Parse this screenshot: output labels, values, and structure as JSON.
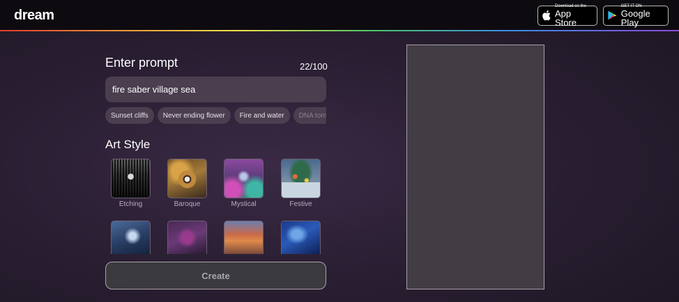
{
  "header": {
    "logo": "dream",
    "app_store": {
      "small": "Download on the",
      "big": "App Store"
    },
    "google_play": {
      "small": "GET IT ON",
      "big": "Google Play"
    }
  },
  "prompt": {
    "title": "Enter prompt",
    "counter": "22/100",
    "value": "fire saber village sea"
  },
  "suggestions": [
    "Sunset cliffs",
    "Never ending flower",
    "Fire and water",
    "DNA tornado"
  ],
  "art_style": {
    "title": "Art Style",
    "styles": [
      "Etching",
      "Baroque",
      "Mystical",
      "Festive"
    ]
  },
  "create_label": "Create"
}
